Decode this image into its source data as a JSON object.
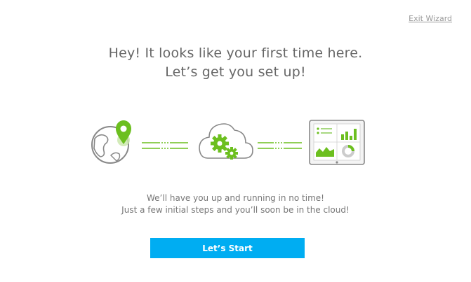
{
  "header": {
    "exit_label": "Exit Wizard"
  },
  "welcome": {
    "title_line1": "Hey! It looks like your first time here.",
    "title_line2": "Let’s get you set up!",
    "body_line1": "We’ll have you up and running in no time!",
    "body_line2": "Just a few initial steps and you’ll soon be in the cloud!"
  },
  "actions": {
    "start_label": "Let’s Start"
  },
  "illustration": {
    "icons": [
      "globe-location-icon",
      "cloud-gears-icon",
      "dashboard-tablet-icon"
    ]
  },
  "colors": {
    "accent_green": "#6cbf1f",
    "button_blue": "#00adf2",
    "text_gray": "#666666",
    "line_gray": "#888888"
  }
}
